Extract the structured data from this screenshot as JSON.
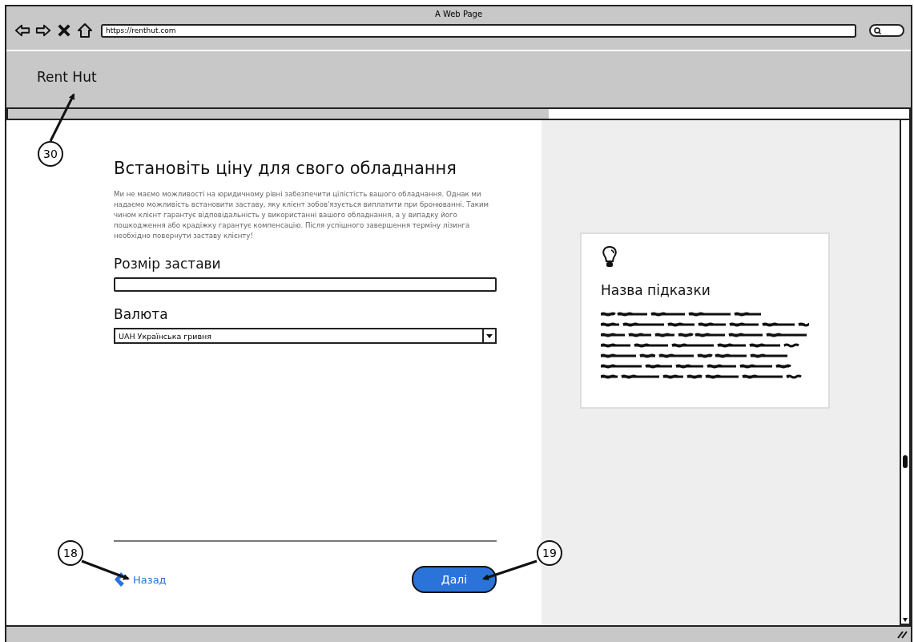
{
  "window": {
    "title": "A Web Page",
    "url": "https://renthut.com"
  },
  "header": {
    "logo": "Rent Hut"
  },
  "progress": {
    "level": 0.6
  },
  "form": {
    "title": "Встановіть ціну для свого обладнання",
    "description": "Ми не маємо можливості на юридичному рівні забезпечити цілістість вашого обладнання. Однак ми надаємо можливість встановити заставу, яку клієнт зобов'язується виплатити при бронюванні. Таким чином клієнт гарантує відповідальність у використанні вашого обладнання, а у випадку його пошкодження або крадіжку гарантує компенсацію. Після успішного завершення терміну лізинга необхідно повернути заставу клієнту!",
    "fields": [
      {
        "kind": "text",
        "label": "Розмір застави"
      },
      {
        "kind": "select",
        "label": "Валюта",
        "value": "UAH Українська гривня"
      }
    ],
    "back": "Назад",
    "next": "Далі"
  },
  "tip": {
    "title": "Назва підказки"
  },
  "callouts": [
    {
      "number": "30"
    },
    {
      "number": "18"
    },
    {
      "number": "19"
    }
  ]
}
